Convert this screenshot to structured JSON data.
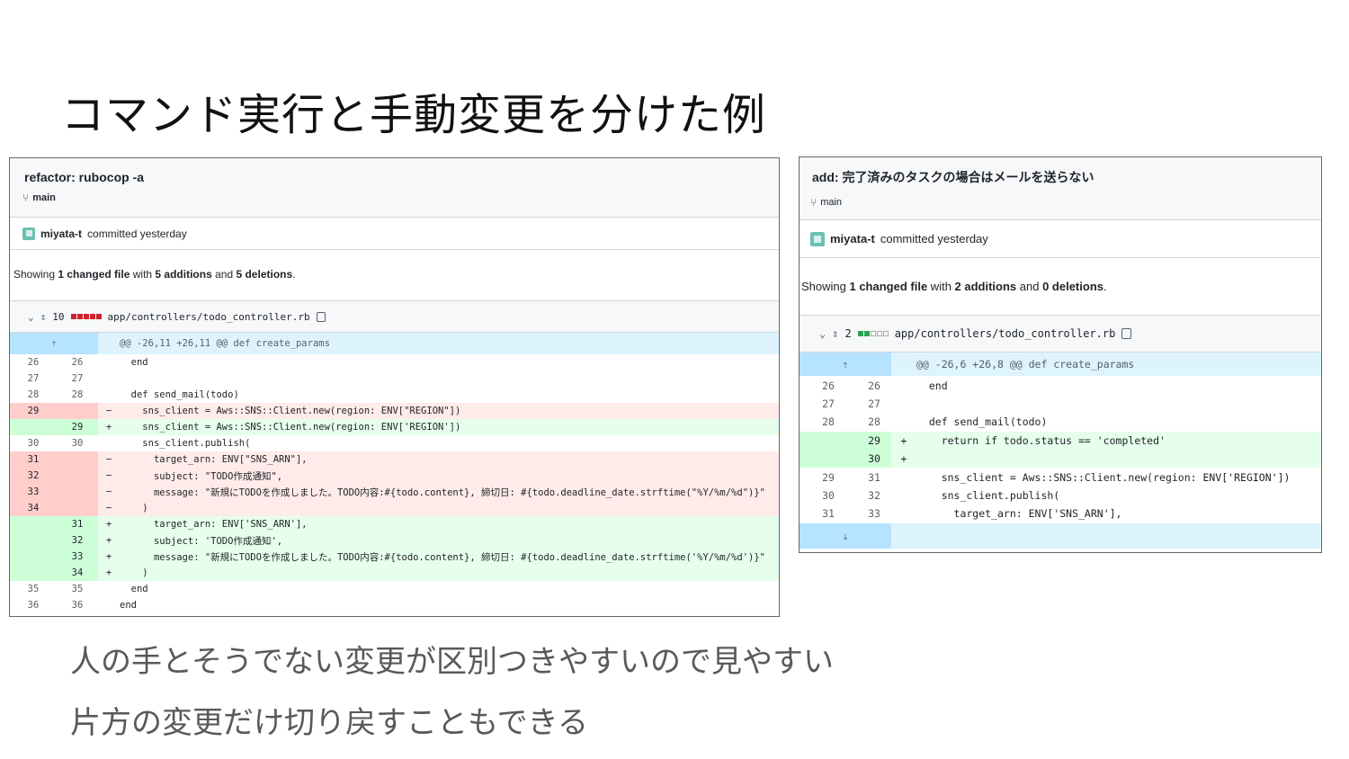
{
  "slide": {
    "title": "コマンド実行と手動変更を分けた例",
    "bullets": [
      "人の手とそうでない変更が区別つきやすいので見やすい",
      "片方の変更だけ切り戻すこともできる"
    ]
  },
  "left_commit": {
    "title": "refactor: rubocop -a",
    "branch": "main",
    "author": "miyata-t",
    "committed": "committed yesterday",
    "summary": {
      "prefix": "Showing ",
      "files": "1 changed file",
      "mid1": " with ",
      "additions": "5 additions",
      "mid2": " and ",
      "deletions": "5 deletions",
      "suffix": "."
    },
    "file": {
      "changes": "10",
      "diffstat": [
        "del",
        "del",
        "del",
        "del",
        "del"
      ],
      "path": "app/controllers/todo_controller.rb"
    },
    "hunk": "@@ -26,11 +26,11 @@ def create_params",
    "lines": [
      {
        "type": "ctx",
        "old": "26",
        "new": "26",
        "mark": "",
        "code": "  end"
      },
      {
        "type": "ctx",
        "old": "27",
        "new": "27",
        "mark": "",
        "code": ""
      },
      {
        "type": "ctx",
        "old": "28",
        "new": "28",
        "mark": "",
        "code": "  def send_mail(todo)"
      },
      {
        "type": "del",
        "old": "29",
        "new": "",
        "mark": "−",
        "code": "    sns_client = Aws::SNS::Client.new(region: ENV[\"REGION\"])"
      },
      {
        "type": "add",
        "old": "",
        "new": "29",
        "mark": "+",
        "code": "    sns_client = Aws::SNS::Client.new(region: ENV['REGION'])"
      },
      {
        "type": "ctx",
        "old": "30",
        "new": "30",
        "mark": "",
        "code": "    sns_client.publish("
      },
      {
        "type": "del",
        "old": "31",
        "new": "",
        "mark": "−",
        "code": "      target_arn: ENV[\"SNS_ARN\"],"
      },
      {
        "type": "del",
        "old": "32",
        "new": "",
        "mark": "−",
        "code": "      subject: \"TODO作成通知\","
      },
      {
        "type": "del",
        "old": "33",
        "new": "",
        "mark": "−",
        "code": "      message: \"新規にTODOを作成しました。TODO内容:#{todo.content}, 締切日: #{todo.deadline_date.strftime(\"%Y/%m/%d\")}\""
      },
      {
        "type": "del",
        "old": "34",
        "new": "",
        "mark": "−",
        "code": "    )"
      },
      {
        "type": "add",
        "old": "",
        "new": "31",
        "mark": "+",
        "code": "      target_arn: ENV['SNS_ARN'],"
      },
      {
        "type": "add",
        "old": "",
        "new": "32",
        "mark": "+",
        "code": "      subject: 'TODO作成通知',"
      },
      {
        "type": "add",
        "old": "",
        "new": "33",
        "mark": "+",
        "code": "      message: \"新規にTODOを作成しました。TODO内容:#{todo.content}, 締切日: #{todo.deadline_date.strftime('%Y/%m/%d')}\""
      },
      {
        "type": "add",
        "old": "",
        "new": "34",
        "mark": "+",
        "code": "    )"
      },
      {
        "type": "ctx",
        "old": "35",
        "new": "35",
        "mark": "",
        "code": "  end"
      },
      {
        "type": "ctx",
        "old": "36",
        "new": "36",
        "mark": "",
        "code": "end"
      }
    ]
  },
  "right_commit": {
    "title": "add: 完了済みのタスクの場合はメールを送らない",
    "branch": "main",
    "author": "miyata-t",
    "committed": "committed yesterday",
    "summary": {
      "prefix": "Showing ",
      "files": "1 changed file",
      "mid1": " with ",
      "additions": "2 additions",
      "mid2": " and ",
      "deletions": "0 deletions",
      "suffix": "."
    },
    "file": {
      "changes": "2",
      "diffstat": [
        "add",
        "add",
        "neu",
        "neu",
        "neu"
      ],
      "path": "app/controllers/todo_controller.rb"
    },
    "hunk": "@@ -26,6 +26,8 @@ def create_params",
    "lines": [
      {
        "type": "ctx",
        "old": "26",
        "new": "26",
        "mark": "",
        "code": "  end"
      },
      {
        "type": "ctx",
        "old": "27",
        "new": "27",
        "mark": "",
        "code": ""
      },
      {
        "type": "ctx",
        "old": "28",
        "new": "28",
        "mark": "",
        "code": "  def send_mail(todo)"
      },
      {
        "type": "add",
        "old": "",
        "new": "29",
        "mark": "+",
        "code": "    return if todo.status == 'completed'"
      },
      {
        "type": "add",
        "old": "",
        "new": "30",
        "mark": "+",
        "code": ""
      },
      {
        "type": "ctx",
        "old": "29",
        "new": "31",
        "mark": "",
        "code": "    sns_client = Aws::SNS::Client.new(region: ENV['REGION'])"
      },
      {
        "type": "ctx",
        "old": "30",
        "new": "32",
        "mark": "",
        "code": "    sns_client.publish("
      },
      {
        "type": "ctx",
        "old": "31",
        "new": "33",
        "mark": "",
        "code": "      target_arn: ENV['SNS_ARN'],"
      }
    ]
  },
  "colors": {
    "add_bg": "#e6ffec",
    "add_num_bg": "#ccffd8",
    "del_bg": "#ffebe9",
    "del_num_bg": "#ffcecb",
    "hunk_bg": "#ddf4ff",
    "bullet_text": "#595959"
  },
  "icons": {
    "branch": "git-branch-icon",
    "avatar": "identicon-avatar",
    "chevron": "chevron-down-icon",
    "expand": "unfold-icon",
    "copy": "copy-icon"
  }
}
